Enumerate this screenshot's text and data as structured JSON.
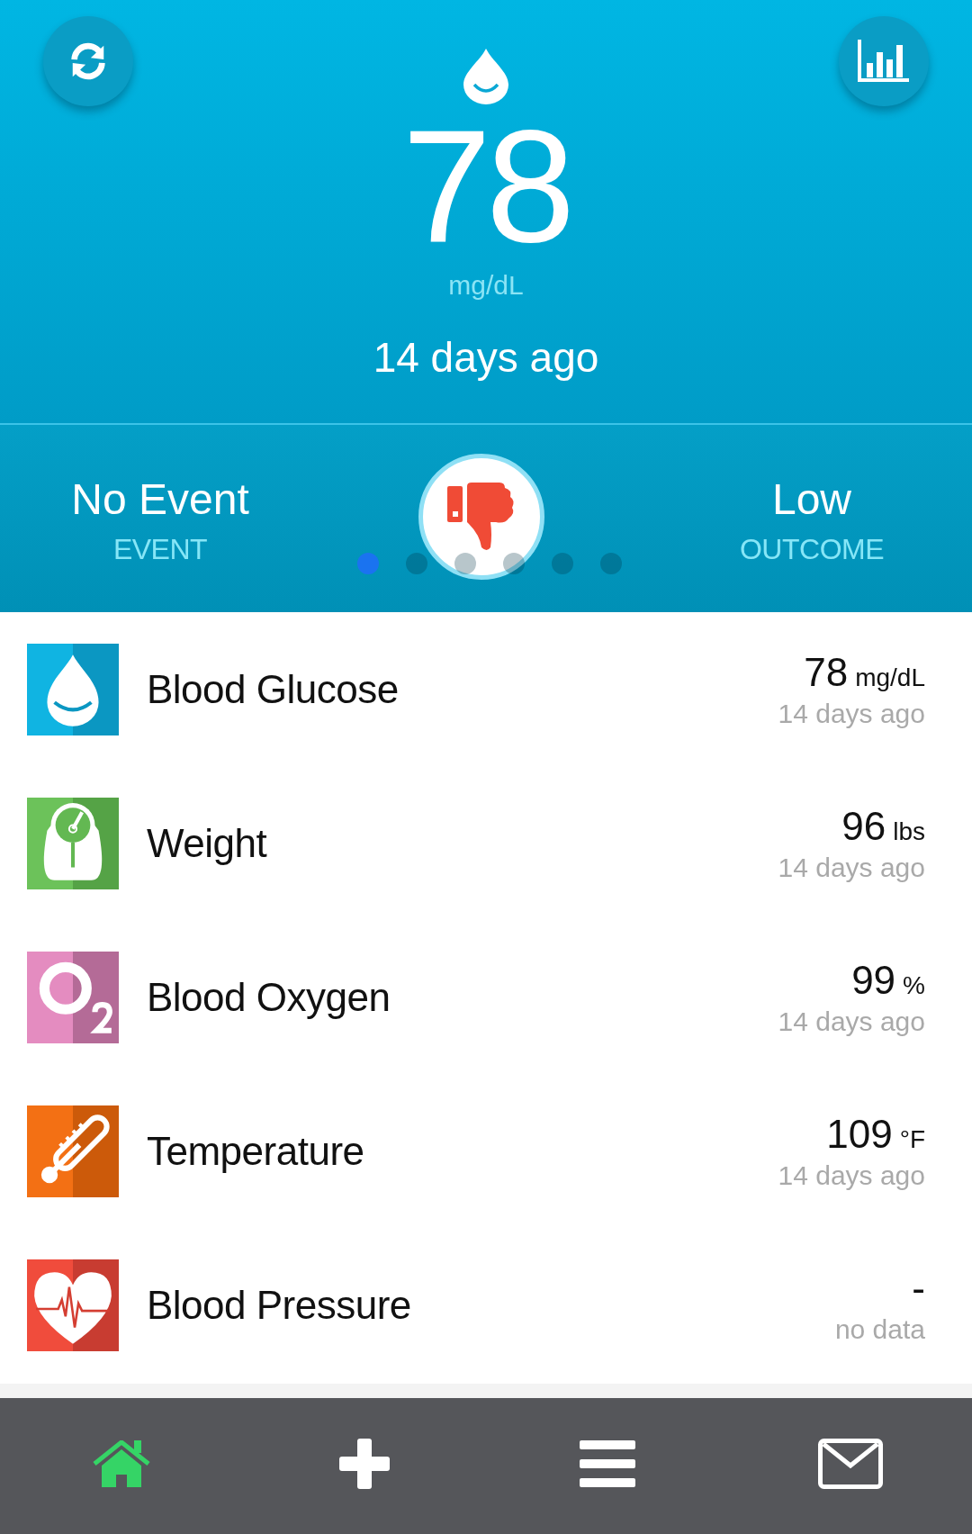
{
  "header": {
    "value": "78",
    "unit": "mg/dL",
    "time": "14 days ago"
  },
  "summary": {
    "event": {
      "value": "No Event",
      "label": "EVENT"
    },
    "outcome": {
      "value": "Low",
      "label": "OUTCOME"
    },
    "pager": [
      {
        "selected": true
      },
      {
        "selected": false
      },
      {
        "selected": false
      },
      {
        "selected": false
      },
      {
        "selected": false
      },
      {
        "selected": false
      }
    ]
  },
  "metrics": [
    {
      "kind": "glucose",
      "name": "Blood Glucose",
      "value": "78",
      "unit": "mg/dL",
      "time": "14 days ago"
    },
    {
      "kind": "weight",
      "name": "Weight",
      "value": "96",
      "unit": "lbs",
      "time": "14 days ago"
    },
    {
      "kind": "oxygen",
      "name": "Blood Oxygen",
      "value": "99",
      "unit": "%",
      "time": "14 days ago"
    },
    {
      "kind": "temperature",
      "name": "Temperature",
      "value": "109",
      "unit": "°F",
      "time": "14 days ago"
    },
    {
      "kind": "pressure",
      "name": "Blood Pressure",
      "value": "-",
      "time": "no data"
    }
  ],
  "nav": [
    {
      "kind": "home",
      "selected": true
    },
    {
      "kind": "add",
      "selected": false
    },
    {
      "kind": "menu",
      "selected": false
    },
    {
      "kind": "mail",
      "selected": false
    }
  ]
}
